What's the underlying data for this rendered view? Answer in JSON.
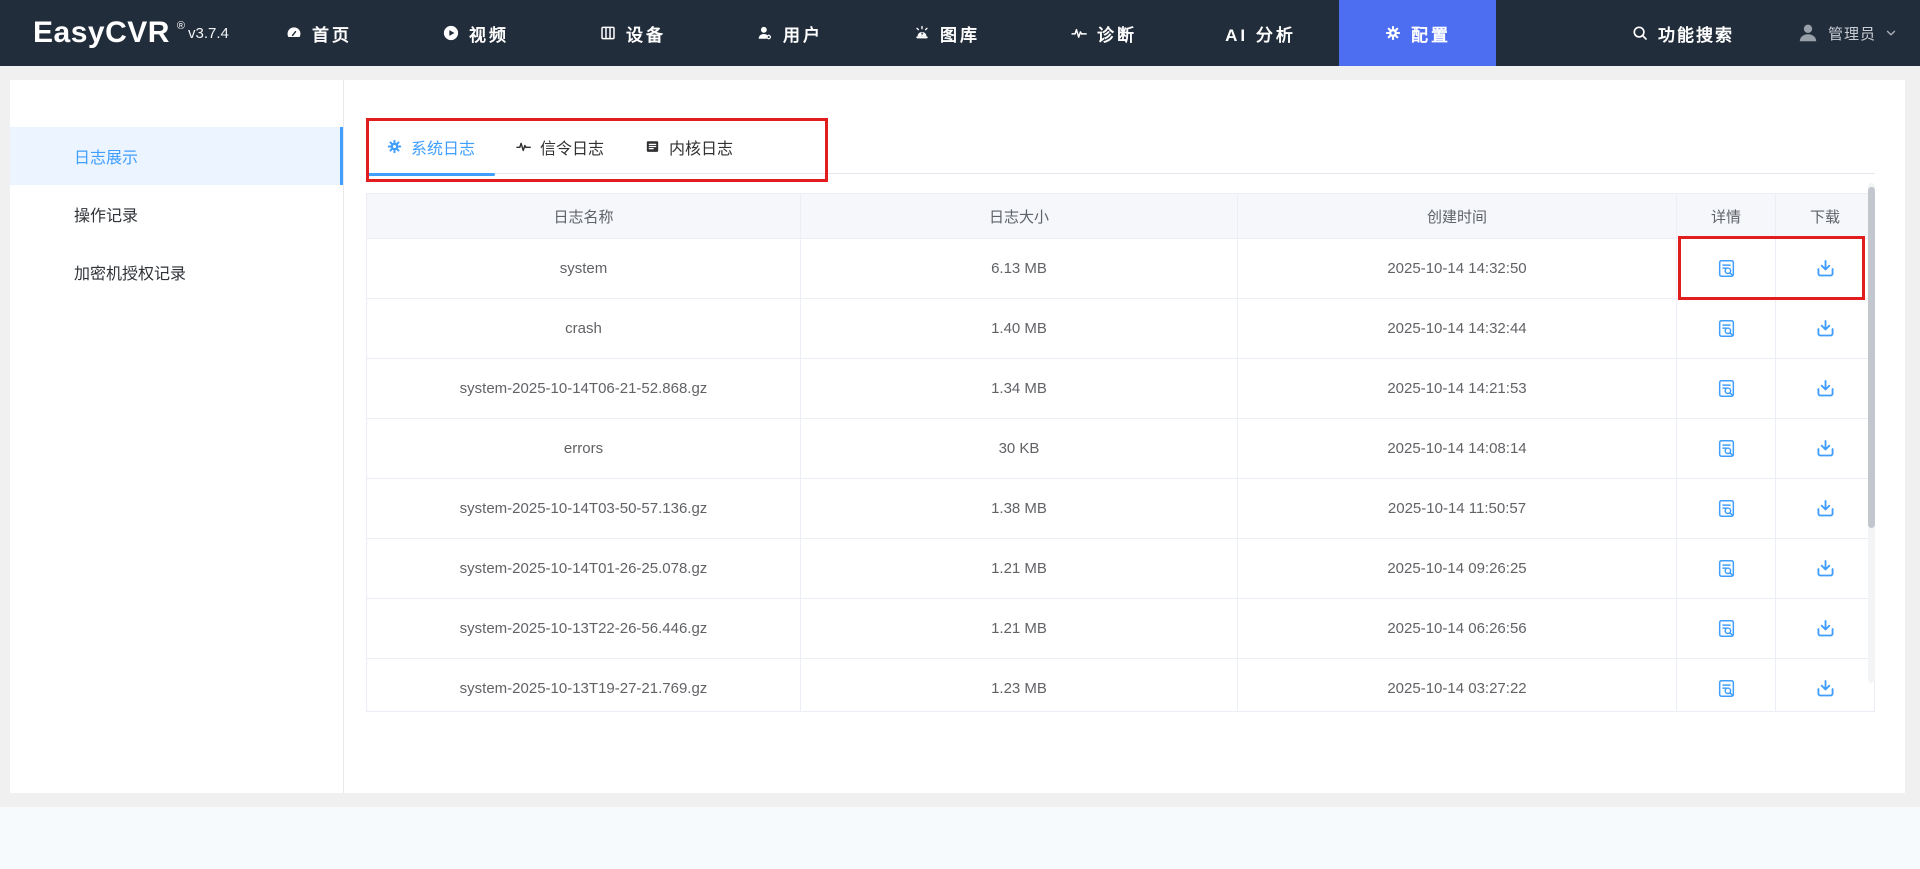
{
  "app": {
    "name": "EasyCVR",
    "registered_mark": "®",
    "version": "v3.7.4"
  },
  "navbar": {
    "items": [
      {
        "label": "首页",
        "icon": "dashboard-icon",
        "active": false
      },
      {
        "label": "视频",
        "icon": "play-circle-icon",
        "active": false
      },
      {
        "label": "设备",
        "icon": "device-rack-icon",
        "active": false
      },
      {
        "label": "用户",
        "icon": "user-gear-icon",
        "active": false
      },
      {
        "label": "图库",
        "icon": "alarm-lamp-icon",
        "active": false
      },
      {
        "label": "诊断",
        "icon": "pulse-icon",
        "active": false
      },
      {
        "label": "AI 分析",
        "icon": null,
        "active": false
      },
      {
        "label": "配置",
        "icon": "gear-icon",
        "active": true
      }
    ],
    "search_label": "功能搜索",
    "user_label": "管理员"
  },
  "sidebar": {
    "items": [
      {
        "label": "日志展示",
        "active": true
      },
      {
        "label": "操作记录",
        "active": false
      },
      {
        "label": "加密机授权记录",
        "active": false
      }
    ]
  },
  "tabs": {
    "items": [
      {
        "label": "系统日志",
        "icon": "gear-icon",
        "active": true
      },
      {
        "label": "信令日志",
        "icon": "pulse-icon",
        "active": false
      },
      {
        "label": "内核日志",
        "icon": "list-doc-icon",
        "active": false
      }
    ]
  },
  "table": {
    "headers": [
      "日志名称",
      "日志大小",
      "创建时间",
      "详情",
      "下载"
    ],
    "row_action_icons": [
      "detail-view-icon",
      "download-icon"
    ],
    "rows": [
      {
        "name": "system",
        "size": "6.13 MB",
        "created": "2025-10-14 14:32:50"
      },
      {
        "name": "crash",
        "size": "1.40 MB",
        "created": "2025-10-14 14:32:44"
      },
      {
        "name": "system-2025-10-14T06-21-52.868.gz",
        "size": "1.34 MB",
        "created": "2025-10-14 14:21:53"
      },
      {
        "name": "errors",
        "size": "30 KB",
        "created": "2025-10-14 14:08:14"
      },
      {
        "name": "system-2025-10-14T03-50-57.136.gz",
        "size": "1.38 MB",
        "created": "2025-10-14 11:50:57"
      },
      {
        "name": "system-2025-10-14T01-26-25.078.gz",
        "size": "1.21 MB",
        "created": "2025-10-14 09:26:25"
      },
      {
        "name": "system-2025-10-13T22-26-56.446.gz",
        "size": "1.21 MB",
        "created": "2025-10-14 06:26:56"
      },
      {
        "name": "system-2025-10-13T19-27-21.769.gz",
        "size": "1.23 MB",
        "created": "2025-10-14 03:27:22"
      }
    ]
  },
  "colors": {
    "navbar_bg": "#222d3b",
    "nav_active_bg": "#4e6ef2",
    "primary": "#409eff",
    "annotation_red": "#e21d1d",
    "sidebar_active_bg": "#ecf5ff",
    "table_header_bg": "#f5f7fa",
    "page_bg": "#f0f0f0",
    "bottom_strip_bg": "#f6fafd"
  }
}
